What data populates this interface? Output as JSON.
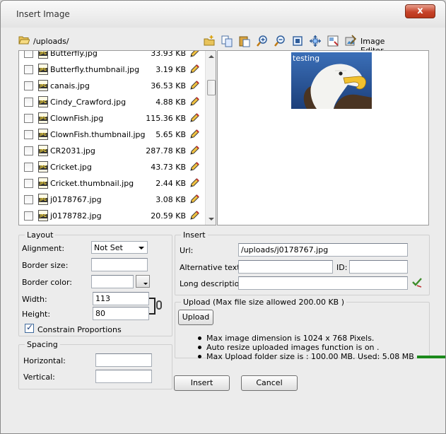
{
  "window": {
    "title": "Insert Image",
    "close_label": "x"
  },
  "toolbar": {
    "path": "/uploads/",
    "image_editor_label": "Image Editor",
    "icons": [
      "new-folder-icon",
      "copy-icon",
      "paste-icon",
      "zoom-in-icon",
      "zoom-out-icon",
      "actual-size-icon",
      "best-fit-icon",
      "properties-icon",
      "image-editor-icon"
    ]
  },
  "files": [
    {
      "name": "Butterfly.jpg",
      "size": "33.93 KB"
    },
    {
      "name": "Butterfly.thumbnail.jpg",
      "size": "3.19 KB"
    },
    {
      "name": "canais.jpg",
      "size": "36.53 KB"
    },
    {
      "name": "Cindy_Crawford.jpg",
      "size": "4.88 KB"
    },
    {
      "name": "ClownFish.jpg",
      "size": "115.36 KB"
    },
    {
      "name": "ClownFish.thumbnail.jpg",
      "size": "5.65 KB"
    },
    {
      "name": "CR2031.jpg",
      "size": "287.78 KB"
    },
    {
      "name": "Cricket.jpg",
      "size": "43.73 KB"
    },
    {
      "name": "Cricket.thumbnail.jpg",
      "size": "2.44 KB"
    },
    {
      "name": "j0178767.jpg",
      "size": "3.08 KB"
    },
    {
      "name": "j0178782.jpg",
      "size": "20.59 KB"
    }
  ],
  "preview": {
    "caption": "testing"
  },
  "layout": {
    "legend": "Layout",
    "alignment_label": "Alignment:",
    "alignment_value": "Not Set",
    "border_size_label": "Border size:",
    "border_size_value": "",
    "border_color_label": "Border color:",
    "border_color_value": "",
    "width_label": "Width:",
    "width_value": "113",
    "height_label": "Height:",
    "height_value": "80",
    "constrain_label": "Constrain Proportions"
  },
  "spacing": {
    "legend": "Spacing",
    "horizontal_label": "Horizontal:",
    "horizontal_value": "",
    "vertical_label": "Vertical:",
    "vertical_value": ""
  },
  "insert": {
    "legend": "Insert",
    "url_label": "Url:",
    "url_value": "/uploads/j0178767.jpg",
    "alt_label": "Alternative text:",
    "alt_value": "",
    "id_label": "ID:",
    "id_value": "",
    "longdesc_label": "Long description:",
    "longdesc_value": ""
  },
  "upload": {
    "legend": "Upload (Max file size allowed 200.00 KB )",
    "button_label": "Upload",
    "notes": [
      "Max image dimension is 1024 x 768 Pixels.",
      "Auto resize uploaded images function is on .",
      "Max Upload folder size is : 100.00 MB. Used: 5.08 MB"
    ],
    "usage_color": "#1b8a1b"
  },
  "actions": {
    "insert_label": "Insert",
    "cancel_label": "Cancel"
  }
}
